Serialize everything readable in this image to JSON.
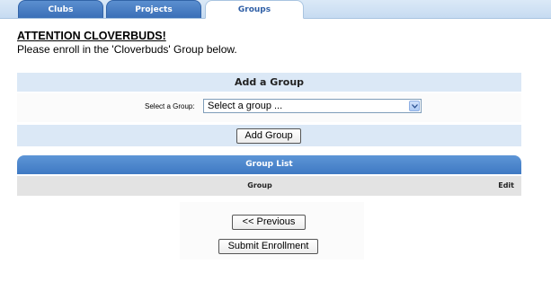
{
  "tabs": [
    {
      "label": "Clubs",
      "active": false
    },
    {
      "label": "Projects",
      "active": false
    },
    {
      "label": "Groups",
      "active": true
    }
  ],
  "notice": {
    "title": "ATTENTION CLOVERBUDS!",
    "message": "Please enroll in the 'Cloverbuds' Group below."
  },
  "add_group": {
    "header": "Add a Group",
    "select_label": "Select a Group:",
    "select_value": "Select a group ...",
    "button_label": "Add Group"
  },
  "group_list": {
    "header": "Group List",
    "columns": [
      "Group",
      "Edit"
    ],
    "rows": []
  },
  "actions": {
    "previous_label": "<< Previous",
    "submit_label": "Submit Enrollment"
  },
  "colors": {
    "tab_inactive": "#3a6fb7",
    "tab_active_text": "#2f5fa6",
    "band_background": "#dbe8f6",
    "list_header": "#4a83c9",
    "column_header": "#e3e3e3"
  }
}
